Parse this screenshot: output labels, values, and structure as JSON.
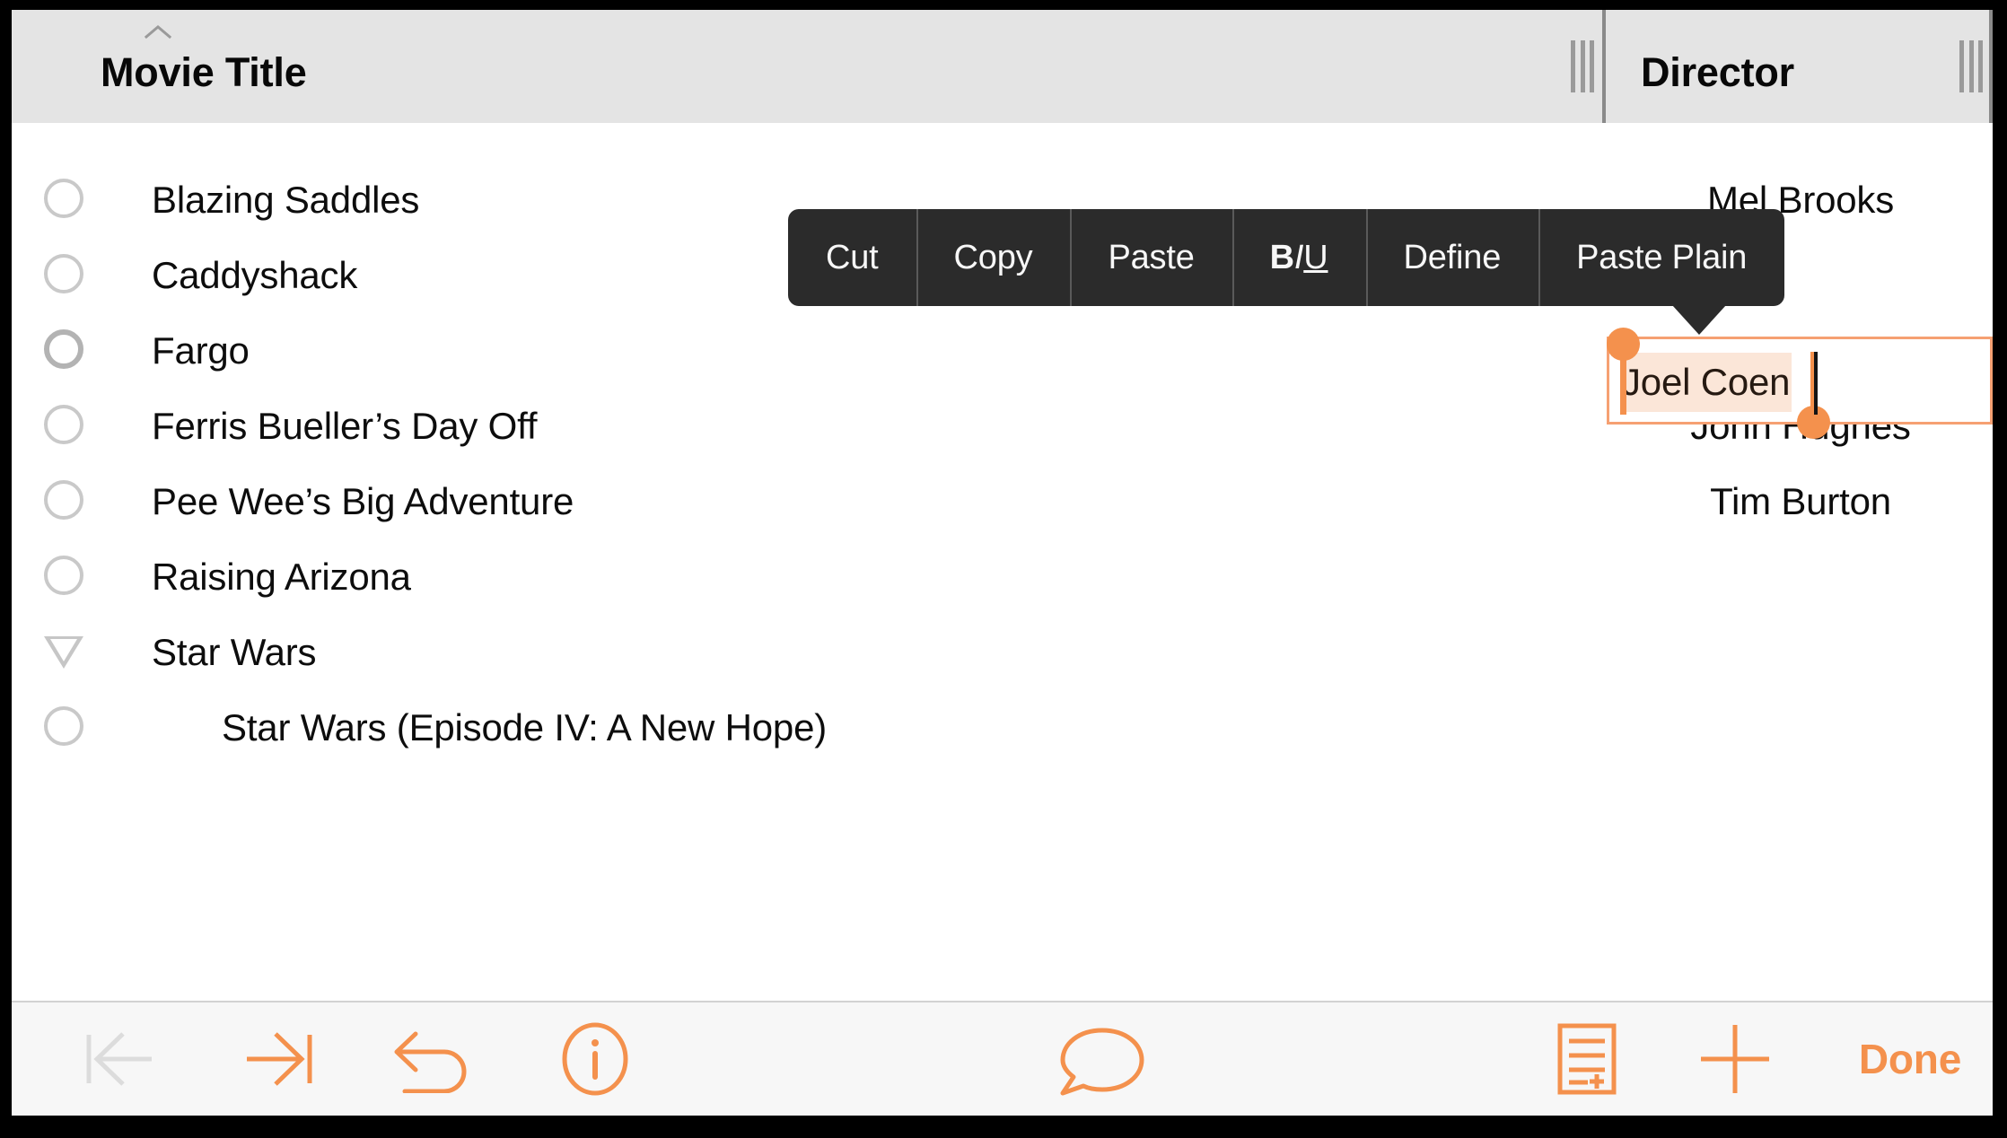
{
  "app": {
    "accent_color": "#f4914d",
    "header_bg": "#e4e4e4",
    "menu_bg": "#2b2b2b",
    "selection_highlight": "#fbe6d8"
  },
  "table": {
    "columns": [
      {
        "key": "movie_title",
        "label": "Movie Title",
        "sort_indicator": "chevron-up-icon"
      },
      {
        "key": "director",
        "label": "Director",
        "sort_indicator": ""
      }
    ],
    "rows": [
      {
        "marker": "circle",
        "selected": false,
        "indent": false,
        "title": "Blazing Saddles",
        "director": "Mel Brooks"
      },
      {
        "marker": "circle",
        "selected": false,
        "indent": false,
        "title": "Caddyshack",
        "director": ""
      },
      {
        "marker": "circle",
        "selected": true,
        "indent": false,
        "title": "Fargo",
        "director": ""
      },
      {
        "marker": "circle",
        "selected": false,
        "indent": false,
        "title": "Ferris Bueller’s Day Off",
        "director": "John Hughes"
      },
      {
        "marker": "circle",
        "selected": false,
        "indent": false,
        "title": "Pee Wee’s Big Adventure",
        "director": "Tim Burton"
      },
      {
        "marker": "circle",
        "selected": false,
        "indent": false,
        "title": "Raising Arizona",
        "director": ""
      },
      {
        "marker": "triangle",
        "selected": false,
        "indent": false,
        "title": "Star Wars",
        "director": ""
      },
      {
        "marker": "circle",
        "selected": false,
        "indent": true,
        "title": "Star Wars (Episode IV: A New Hope)",
        "director": ""
      }
    ]
  },
  "edit_cell": {
    "value": "Joel Coen",
    "selected_text": "Joel Coen",
    "column": "Director",
    "row": "Fargo"
  },
  "popup_menu": {
    "items": [
      {
        "id": "cut",
        "label": "Cut"
      },
      {
        "id": "copy",
        "label": "Copy"
      },
      {
        "id": "paste",
        "label": "Paste"
      },
      {
        "id": "format",
        "label": "BIU",
        "b": "B",
        "i": "I",
        "u": "U"
      },
      {
        "id": "define",
        "label": "Define"
      },
      {
        "id": "paste-plain",
        "label": "Paste Plain"
      }
    ]
  },
  "toolbar": {
    "buttons": [
      {
        "id": "previous-record",
        "icon": "arrow-left-to-bar-icon",
        "label": "",
        "enabled": false
      },
      {
        "id": "next-record",
        "icon": "arrow-right-to-bar-icon",
        "label": "",
        "enabled": true
      },
      {
        "id": "undo",
        "icon": "undo-icon",
        "label": "",
        "enabled": true
      },
      {
        "id": "info",
        "icon": "info-circle-icon",
        "label": "",
        "enabled": true
      },
      {
        "id": "comment",
        "icon": "speech-bubble-icon",
        "label": "",
        "enabled": true
      },
      {
        "id": "new-record",
        "icon": "document-add-icon",
        "label": "",
        "enabled": true
      },
      {
        "id": "add",
        "icon": "plus-icon",
        "label": "",
        "enabled": true
      },
      {
        "id": "done",
        "icon": "",
        "label": "Done",
        "enabled": true
      }
    ],
    "done_label": "Done"
  }
}
